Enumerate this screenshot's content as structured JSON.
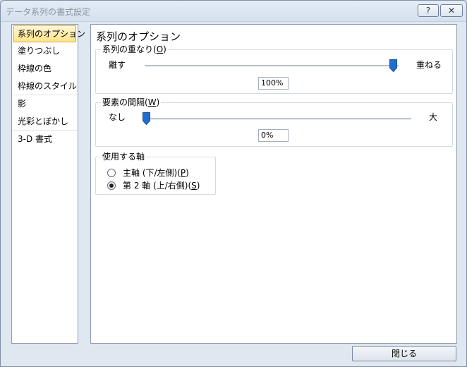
{
  "window": {
    "title": "データ系列の書式設定",
    "help_label": "?",
    "close_label": "✕"
  },
  "sidebar": {
    "items": [
      {
        "label": "系列のオプション",
        "active": true
      },
      {
        "label": "塗りつぶし"
      },
      {
        "label": "枠線の色"
      },
      {
        "label": "枠線のスタイル"
      },
      {
        "label": "影"
      },
      {
        "label": "光彩とぼかし"
      },
      {
        "label": "3-D 書式"
      }
    ]
  },
  "panel": {
    "title": "系列のオプション",
    "overlap": {
      "legend_prefix": "系列の重なり(",
      "legend_key": "O",
      "legend_suffix": ")",
      "left_label": "離す",
      "right_label": "重ねる",
      "value": "100%",
      "level_percent": 100
    },
    "gap": {
      "legend_prefix": "要素の間隔(",
      "legend_key": "W",
      "legend_suffix": ")",
      "left_label": "なし",
      "right_label": "大",
      "value": "0%",
      "level_percent": 0
    },
    "axis": {
      "legend": "使用する軸",
      "primary_prefix": "主軸 (下/左側)(",
      "primary_key": "P",
      "primary_suffix": ")",
      "secondary_prefix": "第 2 軸 (上/右側)(",
      "secondary_key": "S",
      "secondary_suffix": ")",
      "selected": "secondary"
    }
  },
  "footer": {
    "close_label": "閉じる"
  },
  "colors": {
    "thumb": "#1f6fd1",
    "active_item": "#ffe48a"
  }
}
